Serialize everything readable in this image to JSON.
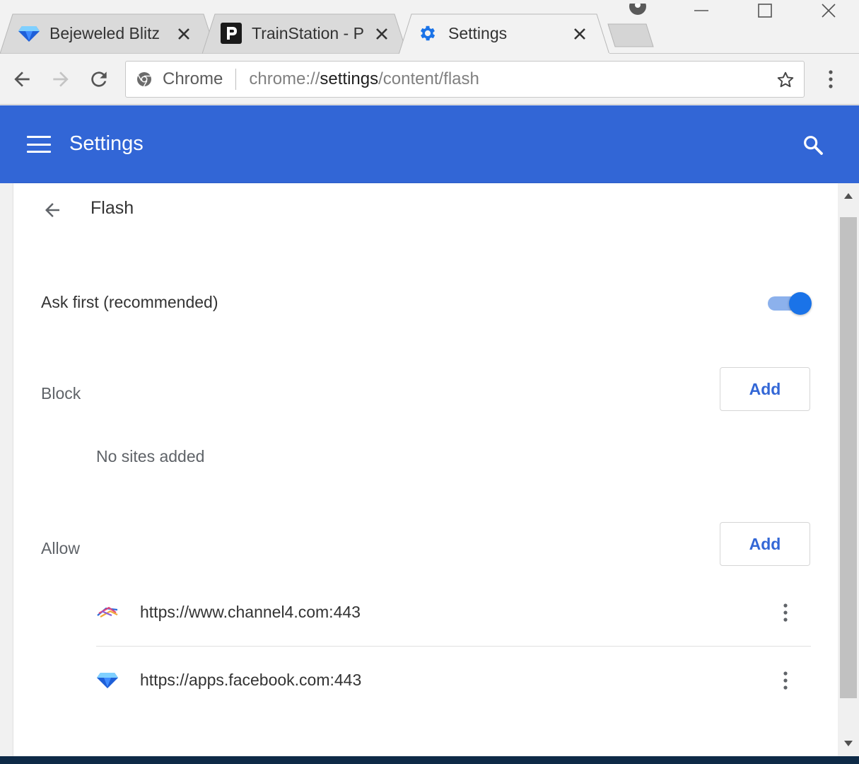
{
  "tabs": [
    {
      "title": "Bejeweled Blitz",
      "icon": "diamond-icon"
    },
    {
      "title": "TrainStation - P",
      "icon": "p-logo-icon"
    },
    {
      "title": "Settings",
      "icon": "gear-icon"
    }
  ],
  "omnibox": {
    "chip_label": "Chrome",
    "url_scheme": "chrome://",
    "url_host": "settings",
    "url_path": "/content/flash"
  },
  "header": {
    "title": "Settings"
  },
  "page": {
    "title": "Flash",
    "ask_first_label": "Ask first (recommended)",
    "ask_first_enabled": true,
    "block": {
      "label": "Block",
      "add_label": "Add",
      "empty_text": "No sites added"
    },
    "allow": {
      "label": "Allow",
      "add_label": "Add",
      "sites": [
        {
          "url": "https://www.channel4.com:443",
          "icon": "channel4-icon"
        },
        {
          "url": "https://apps.facebook.com:443",
          "icon": "diamond-icon"
        }
      ]
    }
  },
  "colors": {
    "header_blue": "#3266d6",
    "toggle_on": "#1a73e8",
    "button_text": "#3367d6"
  }
}
